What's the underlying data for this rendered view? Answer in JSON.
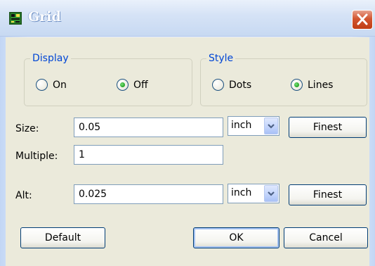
{
  "window": {
    "title": "Grid",
    "icon": "pcb-grid-icon",
    "close_icon": "close-x-icon"
  },
  "display_group": {
    "legend": "Display",
    "options": [
      {
        "label": "On",
        "checked": false
      },
      {
        "label": "Off",
        "checked": true
      }
    ]
  },
  "style_group": {
    "legend": "Style",
    "options": [
      {
        "label": "Dots",
        "checked": false
      },
      {
        "label": "Lines",
        "checked": true
      }
    ]
  },
  "size": {
    "label": "Size:",
    "value": "0.05",
    "unit": "inch",
    "finest_label": "Finest"
  },
  "multiple": {
    "label": "Multiple:",
    "value": "1"
  },
  "alt": {
    "label": "Alt:",
    "value": "0.025",
    "unit": "inch",
    "finest_label": "Finest"
  },
  "buttons": {
    "default_label": "Default",
    "ok_label": "OK",
    "cancel_label": "Cancel"
  },
  "colors": {
    "legend_text": "#0046d5",
    "radio_checked": "#21a121",
    "close_button": "#c03d14",
    "dialog_face": "#ebeadb"
  }
}
